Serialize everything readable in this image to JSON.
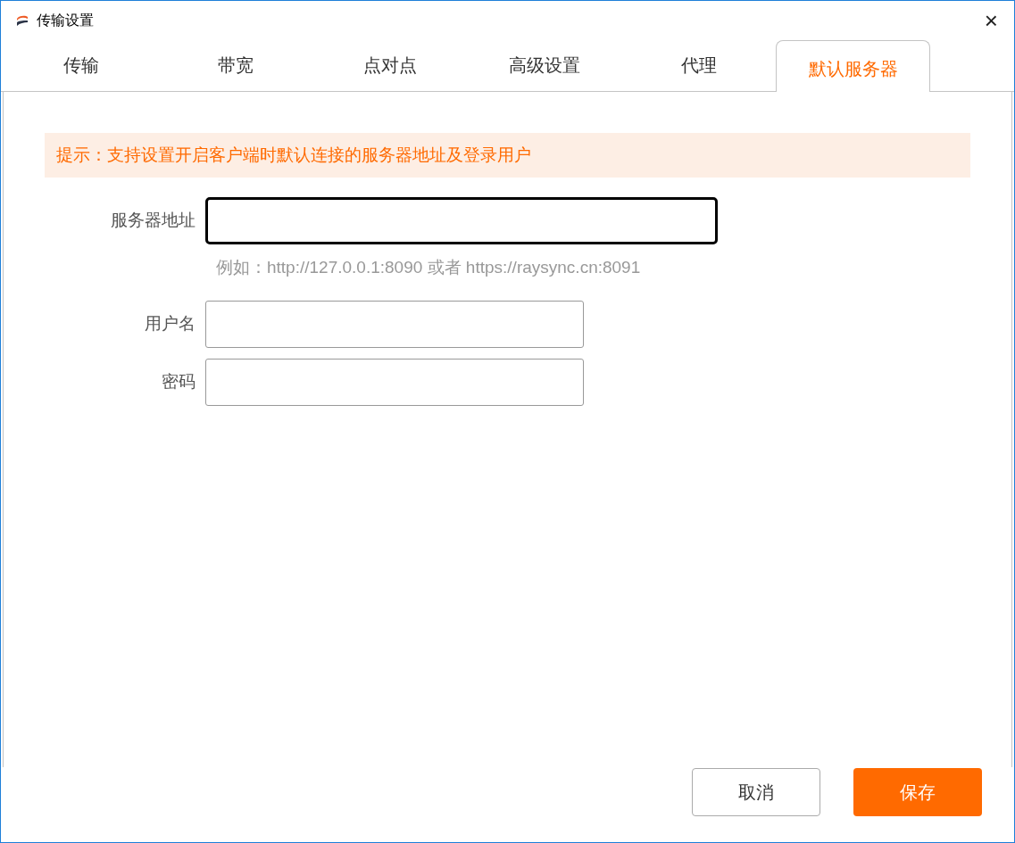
{
  "window": {
    "title": "传输设置",
    "close": "×"
  },
  "tabs": [
    {
      "label": "传输",
      "selected": false
    },
    {
      "label": "带宽",
      "selected": false
    },
    {
      "label": "点对点",
      "selected": false
    },
    {
      "label": "高级设置",
      "selected": false
    },
    {
      "label": "代理",
      "selected": false
    },
    {
      "label": "默认服务器",
      "selected": true
    }
  ],
  "hint": "提示：支持设置开启客户端时默认连接的服务器地址及登录用户",
  "fields": [
    {
      "label": "服务器地址",
      "focused": true,
      "wide": true,
      "example": "例如：http://127.0.0.1:8090 或者 https://raysync.cn:8091"
    },
    {
      "label": "用户名",
      "focused": false,
      "wide": false
    },
    {
      "label": "密码",
      "focused": false,
      "wide": false
    }
  ],
  "buttons": [
    {
      "label": "取消",
      "kind": "secondary"
    },
    {
      "label": "保存",
      "kind": "primary"
    }
  ]
}
